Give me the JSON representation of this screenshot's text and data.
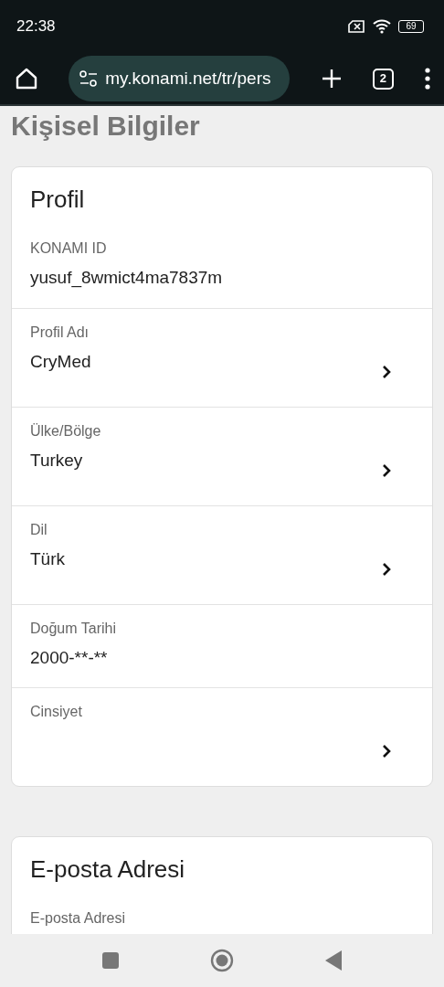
{
  "status_bar": {
    "time": "22:38",
    "battery": "69"
  },
  "browser": {
    "url": "my.konami.net/tr/pers",
    "tab_count": "2"
  },
  "page_title": "Kişisel Bilgiler",
  "sections": [
    {
      "title": "Profil",
      "rows": [
        {
          "label": "KONAMI ID",
          "value": "yusuf_8wmict4ma7837m",
          "chevron": false
        },
        {
          "label": "Profil Adı",
          "value": "CryMed",
          "chevron": true
        },
        {
          "label": "Ülke/Bölge",
          "value": "Turkey",
          "chevron": true
        },
        {
          "label": "Dil",
          "value": "Türk",
          "chevron": true
        },
        {
          "label": "Doğum Tarihi",
          "value": "2000-**-**",
          "chevron": false
        },
        {
          "label": "Cinsiyet",
          "chevron": true
        }
      ]
    },
    {
      "title": "E-posta Adresi",
      "rows": [
        {
          "label": "E-posta Adresi"
        }
      ]
    }
  ]
}
